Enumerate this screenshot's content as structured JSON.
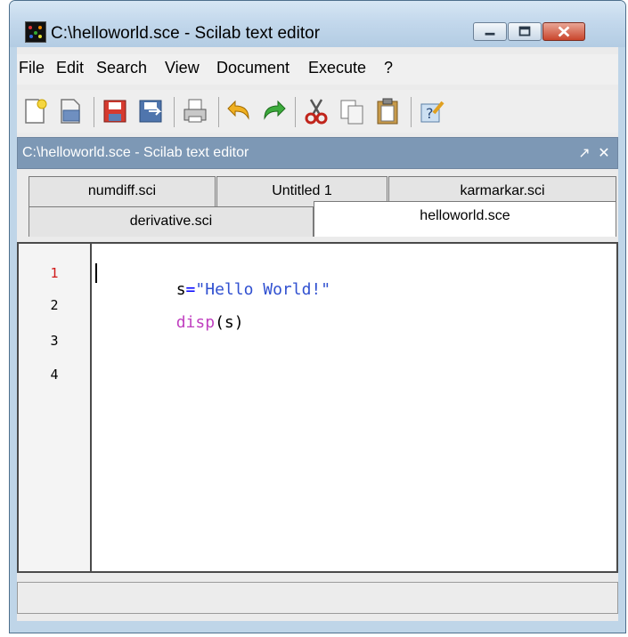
{
  "window": {
    "title": "C:\\helloworld.sce - Scilab text editor",
    "accent_color": "#7d98b5"
  },
  "menu": [
    "File",
    "Edit",
    "Search",
    "View",
    "Document",
    "Execute",
    "?"
  ],
  "toolbar": {
    "icons": [
      "new-file-icon",
      "open-file-icon",
      "save-icon",
      "save-as-icon",
      "print-icon",
      "undo-icon",
      "redo-icon",
      "cut-icon",
      "copy-icon",
      "paste-icon",
      "help-icon"
    ]
  },
  "panel": {
    "title": "C:\\helloworld.sce - Scilab text editor",
    "undock_glyph": "↗",
    "close_glyph": "✕"
  },
  "tabs": {
    "row1": [
      "numdiff.sci",
      "Untitled 1",
      "karmarkar.sci"
    ],
    "row2": [
      "derivative.sci",
      "helloworld.sce"
    ],
    "active": "helloworld.sce"
  },
  "editor": {
    "line_numbers": [
      "1",
      "2",
      "3",
      "4"
    ],
    "current_line": "1",
    "lines": [
      [
        {
          "text": "s",
          "color": "#000000"
        },
        {
          "text": "=",
          "color": "#0000ff"
        },
        {
          "text": "\"Hello World!\"",
          "color": "#3050d0"
        }
      ],
      [
        {
          "text": "disp",
          "color": "#c040c0"
        },
        {
          "text": "(",
          "color": "#000000"
        },
        {
          "text": "s",
          "color": "#000000"
        },
        {
          "text": ")",
          "color": "#000000"
        }
      ]
    ]
  },
  "statusbar": {
    "text": ""
  }
}
